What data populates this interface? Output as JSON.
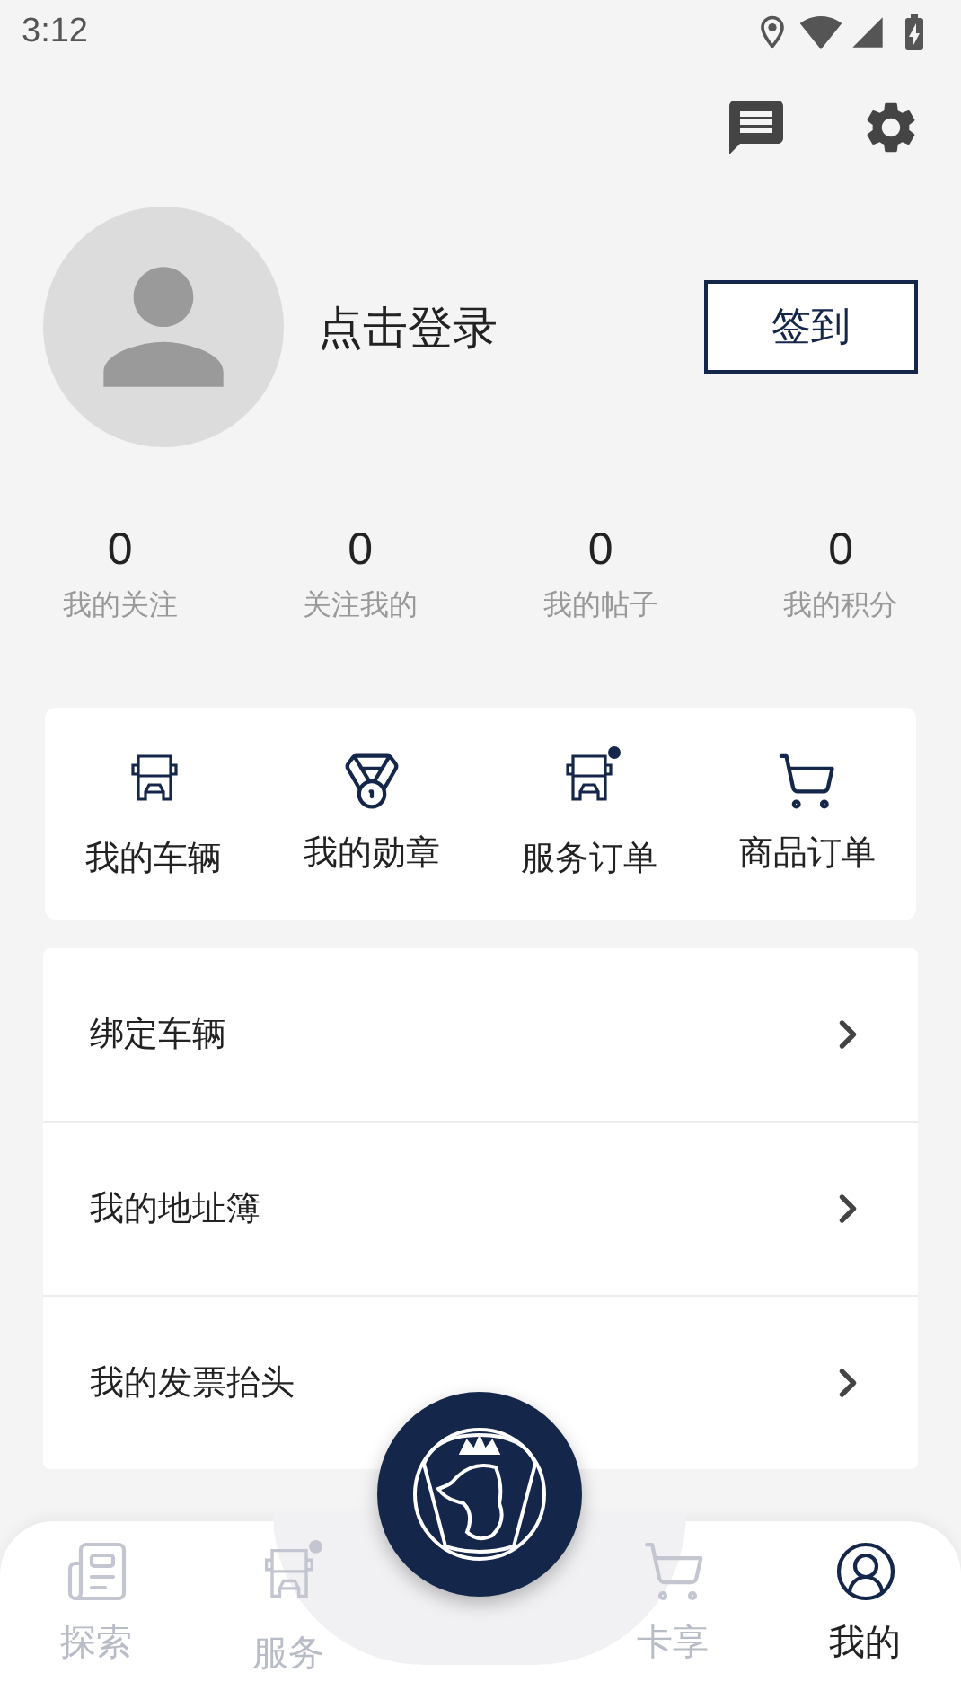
{
  "status_bar": {
    "time": "3:12"
  },
  "profile": {
    "login": "点击登录",
    "checkin_button": "签到"
  },
  "stats": [
    {
      "value": "0",
      "label": "我的关注"
    },
    {
      "value": "0",
      "label": "关注我的"
    },
    {
      "value": "0",
      "label": "我的帖子"
    },
    {
      "value": "0",
      "label": "我的积分"
    }
  ],
  "shortcuts": [
    {
      "label": "我的车辆"
    },
    {
      "label": "我的勋章"
    },
    {
      "label": "服务订单"
    },
    {
      "label": "商品订单"
    }
  ],
  "menu": [
    {
      "label": "绑定车辆"
    },
    {
      "label": "我的地址簿"
    },
    {
      "label": "我的发票抬头"
    }
  ],
  "tab_bar": [
    {
      "label": "探索",
      "selected": false
    },
    {
      "label": "服务",
      "selected": false
    },
    {
      "label": "卡享",
      "selected": false
    },
    {
      "label": "我的",
      "selected": true
    }
  ]
}
